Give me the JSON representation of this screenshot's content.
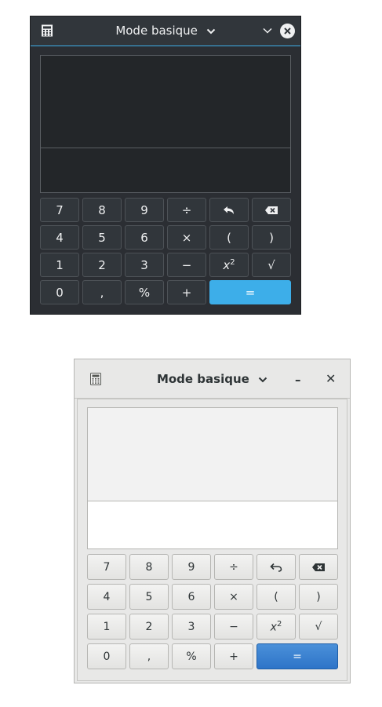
{
  "dark": {
    "title": "Mode basique",
    "title_chevron": "chevron-down-icon",
    "app_icon": "calculator-icon",
    "buttons": {
      "seven": "7",
      "eight": "8",
      "nine": "9",
      "divide": "÷",
      "four": "4",
      "five": "5",
      "six": "6",
      "multiply": "×",
      "open_paren": "(",
      "close_paren": ")",
      "one": "1",
      "two": "2",
      "three": "3",
      "minus": "−",
      "square_base": "x",
      "square_exp": "2",
      "sqrt": "√",
      "zero": "0",
      "comma": ",",
      "percent": "%",
      "plus": "+",
      "equals": "="
    },
    "accent": "#3daee9"
  },
  "light": {
    "title": "Mode basique",
    "title_chevron": "chevron-down-icon",
    "app_icon": "calculator-icon",
    "minimize_label": "–",
    "close_label": "✕",
    "buttons": {
      "seven": "7",
      "eight": "8",
      "nine": "9",
      "divide": "÷",
      "four": "4",
      "five": "5",
      "six": "6",
      "multiply": "×",
      "open_paren": "(",
      "close_paren": ")",
      "one": "1",
      "two": "2",
      "three": "3",
      "minus": "−",
      "square_base": "x",
      "square_exp": "2",
      "sqrt": "√",
      "zero": "0",
      "comma": ",",
      "percent": "%",
      "plus": "+",
      "equals": "="
    },
    "accent": "#3584e4"
  }
}
